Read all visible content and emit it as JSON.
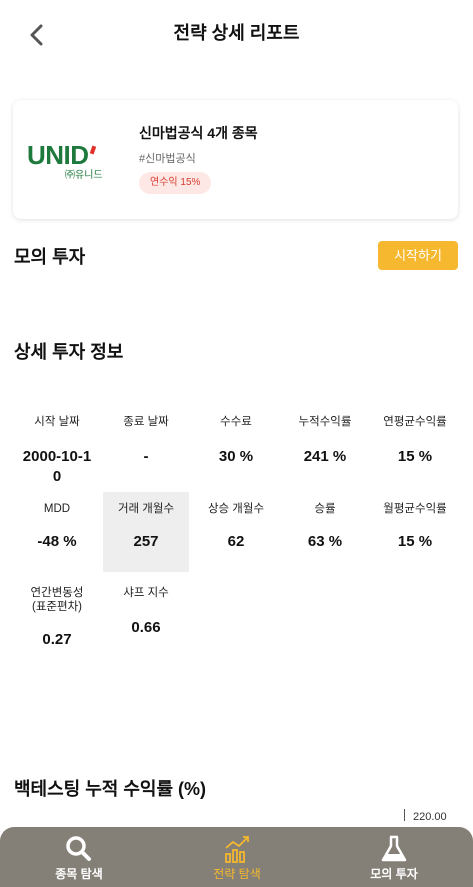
{
  "header": {
    "title": "전략 상세 리포트"
  },
  "card": {
    "logo_text": "UNID",
    "logo_sub": "㈜유니드",
    "name": "신마법공식 4개 종목",
    "tag": "#신마법공식",
    "badge": "연수익 15%"
  },
  "mock": {
    "title": "모의 투자",
    "start_label": "시작하기"
  },
  "info": {
    "title": "상세 투자 정보",
    "cells": [
      {
        "label": "시작 날짜",
        "value": "2000-10-10"
      },
      {
        "label": "종료 날짜",
        "value": "-"
      },
      {
        "label": "수수료",
        "value": "30 %"
      },
      {
        "label": "누적수익률",
        "value": "241 %"
      },
      {
        "label": "연평균수익률",
        "value": "15 %"
      },
      {
        "label": "MDD",
        "value": "-48 %"
      },
      {
        "label": "거래 개월수",
        "value": "257"
      },
      {
        "label": "상승 개월수",
        "value": "62"
      },
      {
        "label": "승률",
        "value": "63 %"
      },
      {
        "label": "월평균수익률",
        "value": "15 %"
      },
      {
        "label": "연간변동성 (표준편차)",
        "value": "0.27"
      },
      {
        "label": "샤프 지수",
        "value": "0.66"
      }
    ]
  },
  "backtest": {
    "title": "백테스팅 누적 수익률 (%)",
    "axis_top": "220.00"
  },
  "nav": {
    "items": [
      {
        "label": "종목 탐색",
        "icon": "search-icon"
      },
      {
        "label": "전략 탐색",
        "icon": "chart-icon"
      },
      {
        "label": "모의 투자",
        "icon": "flask-icon"
      }
    ]
  }
}
